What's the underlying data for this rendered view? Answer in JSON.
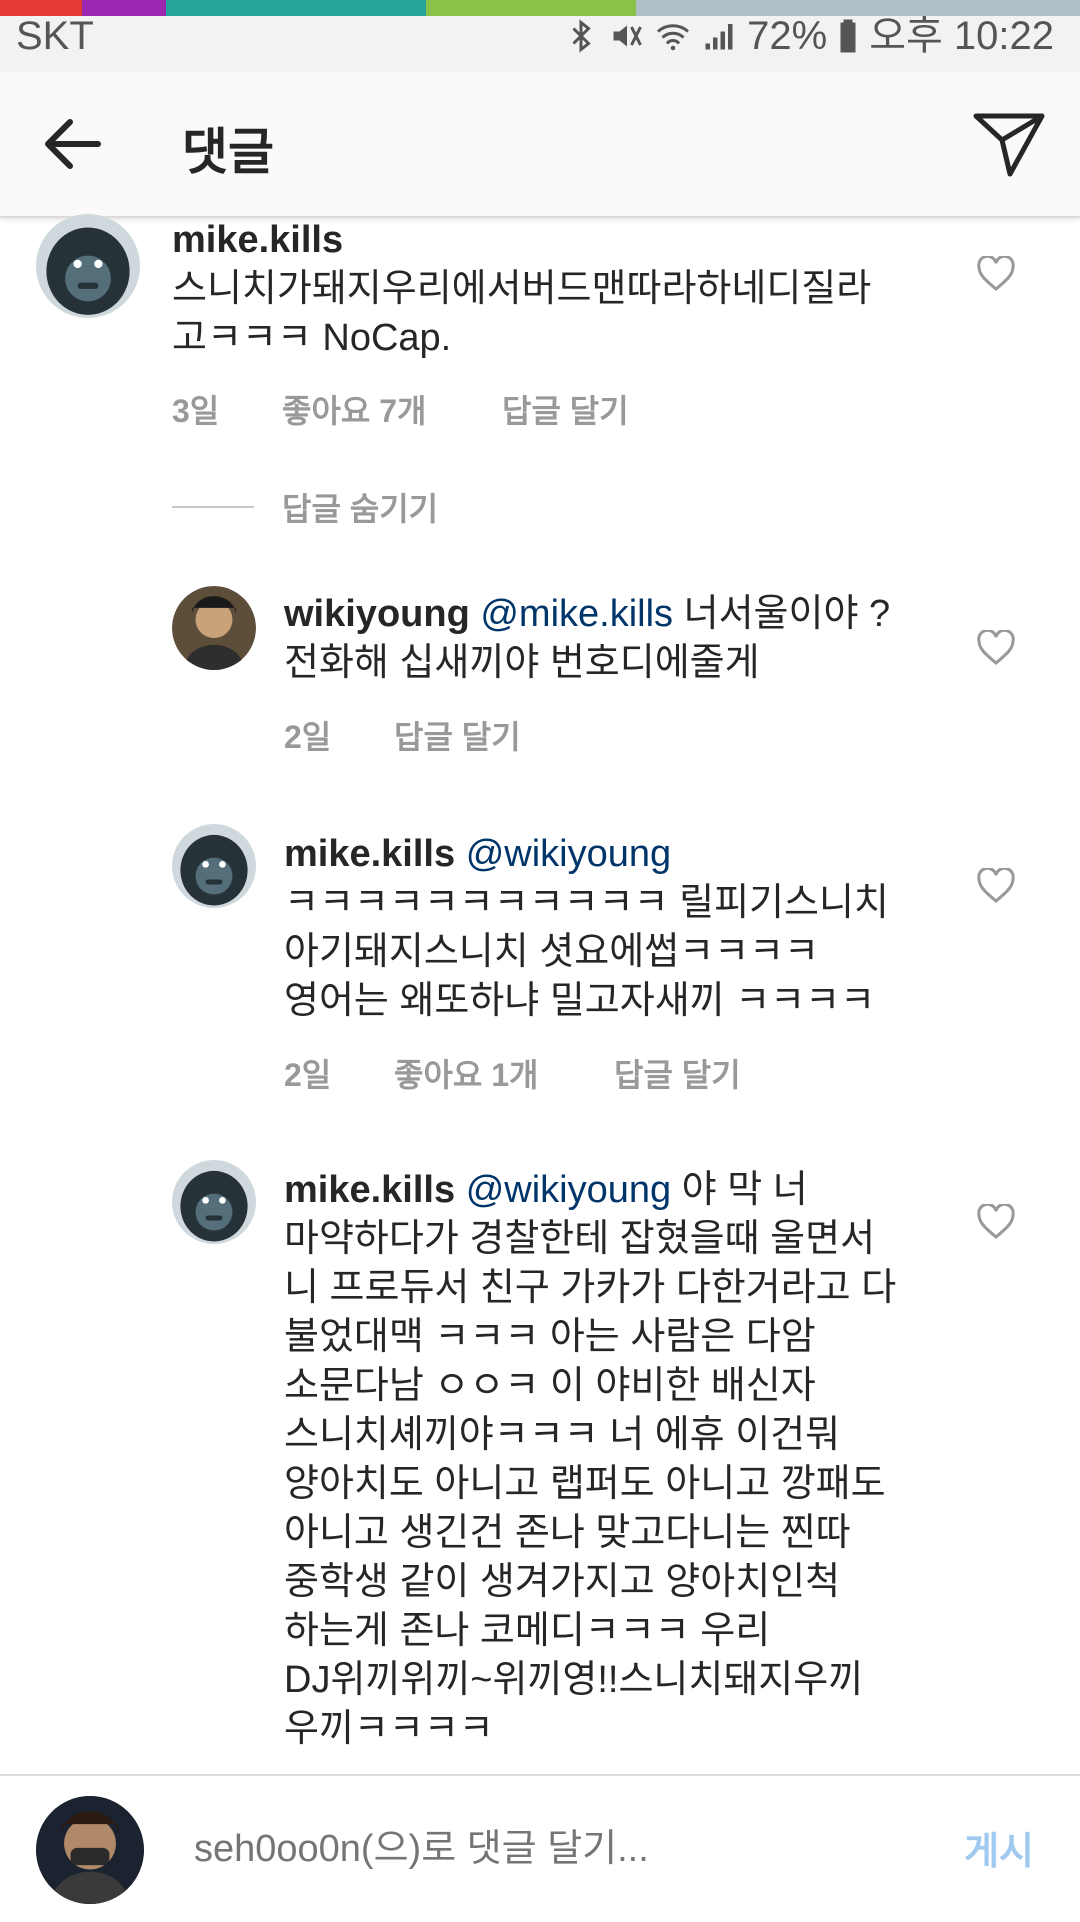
{
  "status_bar": {
    "carrier": "SKT",
    "battery": "72%",
    "time": "오후 10:22",
    "icons": [
      "bluetooth-icon",
      "mute-icon",
      "wifi-icon",
      "signal-icon",
      "battery-icon"
    ]
  },
  "header": {
    "title": "댓글",
    "back_icon": "arrow-left-icon",
    "send_icon": "paper-plane-icon"
  },
  "comments": [
    {
      "user": "mike.kills",
      "mention": "",
      "text_lines": [
        "스니치가돼지우리에서버드맨따라하네디질라",
        "고ㅋㅋㅋ NoCap."
      ],
      "age": "3일",
      "likes": "좋아요 7개",
      "reply": "답글 달기"
    },
    {
      "user": "wikiyoung",
      "mention": "@mike.kills",
      "text_lines": [
        " 너서울이야 ?",
        "전화해 십새끼야 번호디에줄게"
      ],
      "age": "2일",
      "likes": "",
      "reply": "답글 달기"
    },
    {
      "user": "mike.kills",
      "mention": "@wikiyoung",
      "text_lines": [
        "",
        "ㅋㅋㅋㅋㅋㅋㅋㅋㅋㅋㅋ 릴피기스니치",
        "아기돼지스니치 셧요에썹ㅋㅋㅋㅋ",
        "영어는 왜또하냐 밀고자새끼 ㅋㅋㅋㅋ"
      ],
      "age": "2일",
      "likes": "좋아요 1개",
      "reply": "답글 달기"
    },
    {
      "user": "mike.kills",
      "mention": "@wikiyoung",
      "text_lines": [
        " 야 막 너",
        "마약하다가 경찰한테 잡혔을때 울면서",
        "니 프로듀서 친구 가카가 다한거라고 다",
        "불었대맥 ㅋㅋㅋ 아는 사람은 다암",
        "소문다남 ㅇㅇㅋ 이 야비한 배신자",
        "스니치셰끼야ㅋㅋㅋ 너 에휴 이건뭐",
        "양아치도 아니고 랩퍼도 아니고 깡패도",
        "아니고 생긴건 존나 맞고다니는 찐따",
        "중학생 같이 생겨가지고 양아치인척",
        "하는게 존나 코메디ㅋㅋㅋ 우리",
        "DJ위끼위끼~위끼영!!스니치돼지우끼",
        "우끼ㅋㅋㅋㅋ"
      ]
    }
  ],
  "hide_replies": "답글 숨기기",
  "composer": {
    "placeholder": "seh0oo0n(으)로 댓글 달기...",
    "post_label": "게시"
  },
  "colors": {
    "mention": "#003569",
    "meta": "#999999",
    "post_disabled": "#9fc9ef"
  }
}
